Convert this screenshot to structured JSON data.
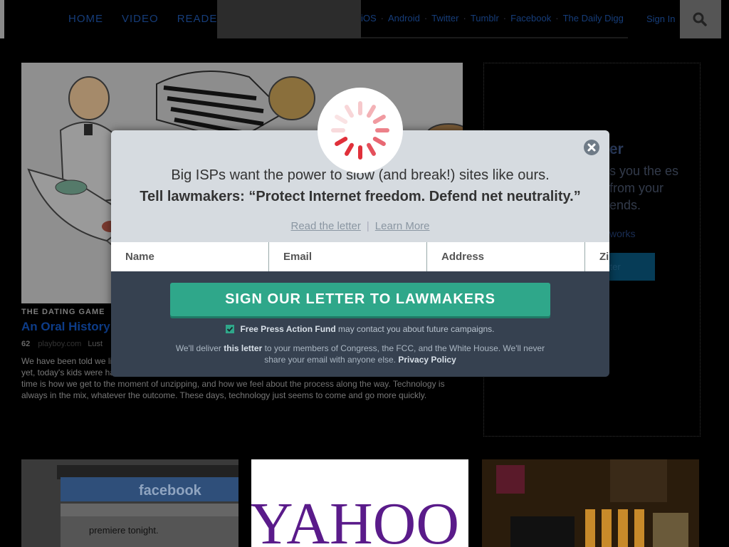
{
  "nav": {
    "items": [
      "HOME",
      "VIDEO",
      "READER"
    ],
    "social": [
      "iOS",
      "Android",
      "Twitter",
      "Tumblr",
      "Facebook",
      "The Daily Digg"
    ],
    "signin": "Sign In"
  },
  "feature": {
    "kicker": "THE DATING GAME",
    "headline": "An Oral History",
    "count": "62",
    "source": "playboy.com",
    "meta_extra": "Lust",
    "excerpt_1": "We have been told we li",
    "excerpt_2": "yet, today's kids were ha",
    "excerpt_3": "time is how we get to the moment of unzipping, and how we feel about the process along the way. Technology is",
    "excerpt_4": "always in the mix, whatever the outcome. These days, technology just seems to come and go more quickly."
  },
  "right_card": {
    "title_partial": "per",
    "text_partial": "s you the es from your ends.",
    "link_partial": "works",
    "button_partial": "itter"
  },
  "modal": {
    "tagline": "Big ISPs want the power to slow (and break!) sites like ours.",
    "headline": "Tell lawmakers: “Protect Internet freedom. Defend net neutrality.”",
    "read_letter": "Read the letter",
    "learn_more": "Learn More",
    "divider": "|",
    "placeholders": {
      "name": "Name",
      "email": "Email",
      "address": "Address",
      "zip": "Zip / Postcode"
    },
    "sign_button": "SIGN OUR LETTER TO LAWMAKERS",
    "consent_org": "Free Press Action Fund",
    "consent_rest": " may contact you about future campaigns.",
    "deliver_1": "We'll deliver ",
    "deliver_bold": "this letter",
    "deliver_2": " to your members of Congress, the FCC, and the White House. We'll never share your email with anyone else. ",
    "privacy": "Privacy Policy"
  },
  "tiles": {
    "tile1_text": "facebook",
    "tile1_sub": "premiere tonight.",
    "tile2_text": "YAHOO"
  },
  "colors": {
    "accent_green": "#2fa78a",
    "nav_blue": "#163d7a",
    "spinner_red": "#e0303a"
  }
}
